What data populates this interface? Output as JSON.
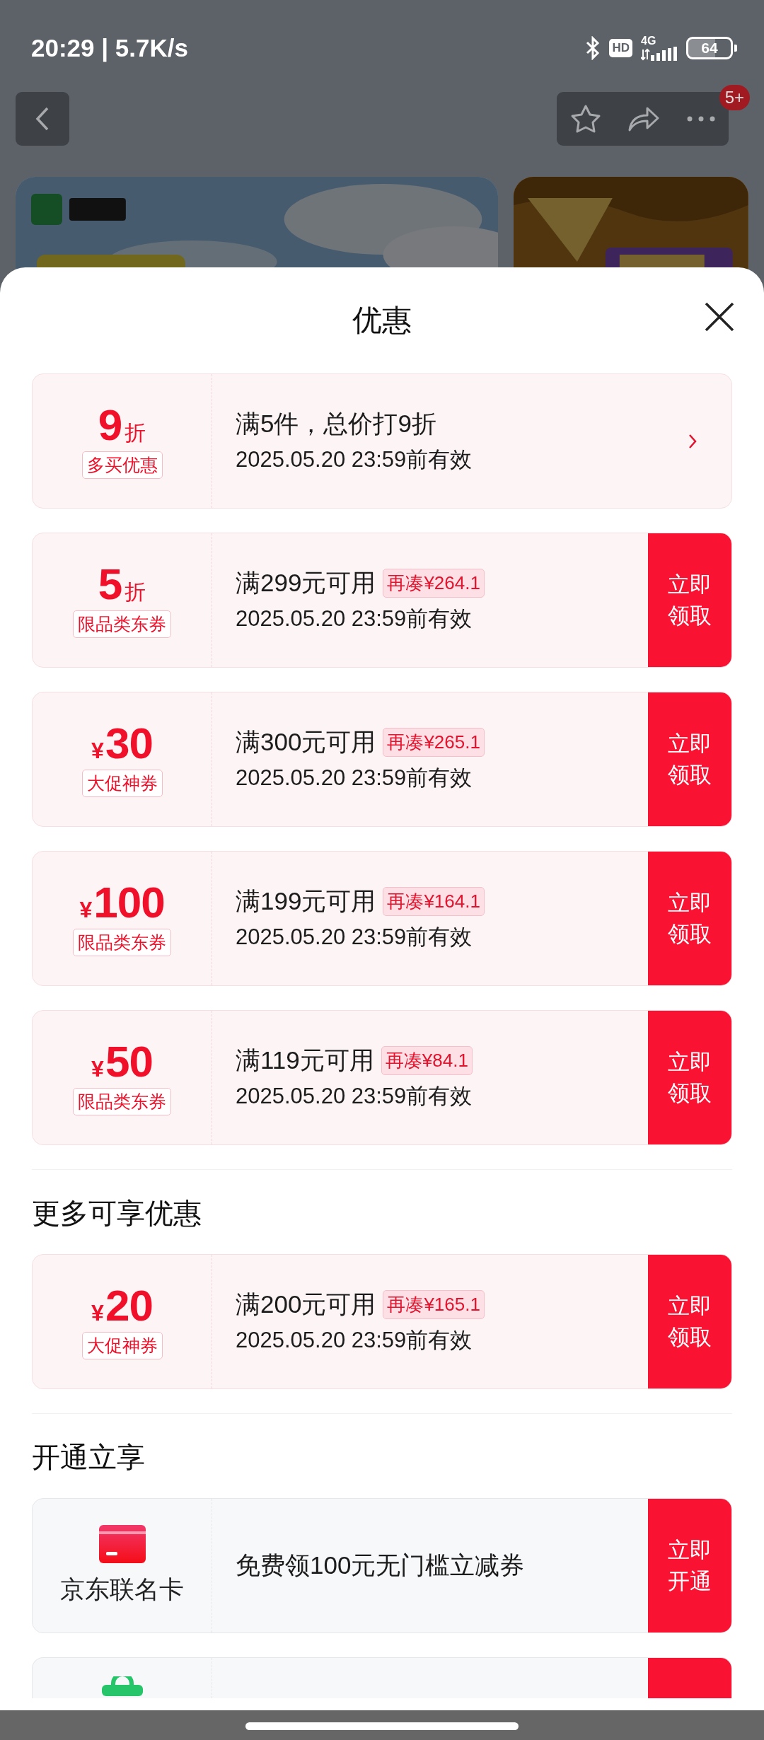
{
  "status_bar": {
    "time": "20:29 | 5.7K/s",
    "hd": "HD",
    "network": "4G",
    "battery": "64"
  },
  "header": {
    "badge": "5+"
  },
  "sheet": {
    "title": "优惠",
    "sections": [
      {
        "items": [
          {
            "kind": "discount",
            "value": "9",
            "unit": "折",
            "tag": "多买优惠",
            "condition": "满5件，总价打9折",
            "validity": "2025.05.20 23:59前有效",
            "action": {
              "kind": "arrow"
            }
          },
          {
            "kind": "discount",
            "value": "5",
            "unit": "折",
            "tag": "限品类东券",
            "condition": "满299元可用",
            "gap": "再凑¥264.1",
            "validity": "2025.05.20 23:59前有效",
            "action": {
              "kind": "button",
              "label": "立即领取"
            }
          },
          {
            "kind": "amount",
            "currency": "¥",
            "value": "30",
            "tag": "大促神券",
            "condition": "满300元可用",
            "gap": "再凑¥265.1",
            "validity": "2025.05.20 23:59前有效",
            "action": {
              "kind": "button",
              "label": "立即领取"
            }
          },
          {
            "kind": "amount",
            "currency": "¥",
            "value": "100",
            "tag": "限品类东券",
            "condition": "满199元可用",
            "gap": "再凑¥164.1",
            "validity": "2025.05.20 23:59前有效",
            "action": {
              "kind": "button",
              "label": "立即领取"
            }
          },
          {
            "kind": "amount",
            "currency": "¥",
            "value": "50",
            "tag": "限品类东券",
            "condition": "满119元可用",
            "gap": "再凑¥84.1",
            "validity": "2025.05.20 23:59前有效",
            "action": {
              "kind": "button",
              "label": "立即领取"
            }
          }
        ]
      },
      {
        "heading": "更多可享优惠",
        "items": [
          {
            "kind": "amount",
            "currency": "¥",
            "value": "20",
            "tag": "大促神券",
            "condition": "满200元可用",
            "gap": "再凑¥165.1",
            "validity": "2025.05.20 23:59前有效",
            "action": {
              "kind": "button",
              "label": "立即领取"
            }
          }
        ]
      },
      {
        "heading": "开通立享",
        "items": [
          {
            "kind": "service",
            "name": "京东联名卡",
            "text": "免费领100元无门槛立减券",
            "action": {
              "kind": "button",
              "label": "立即开通"
            }
          },
          {
            "kind": "service",
            "action": {
              "kind": "button"
            }
          }
        ]
      }
    ]
  }
}
